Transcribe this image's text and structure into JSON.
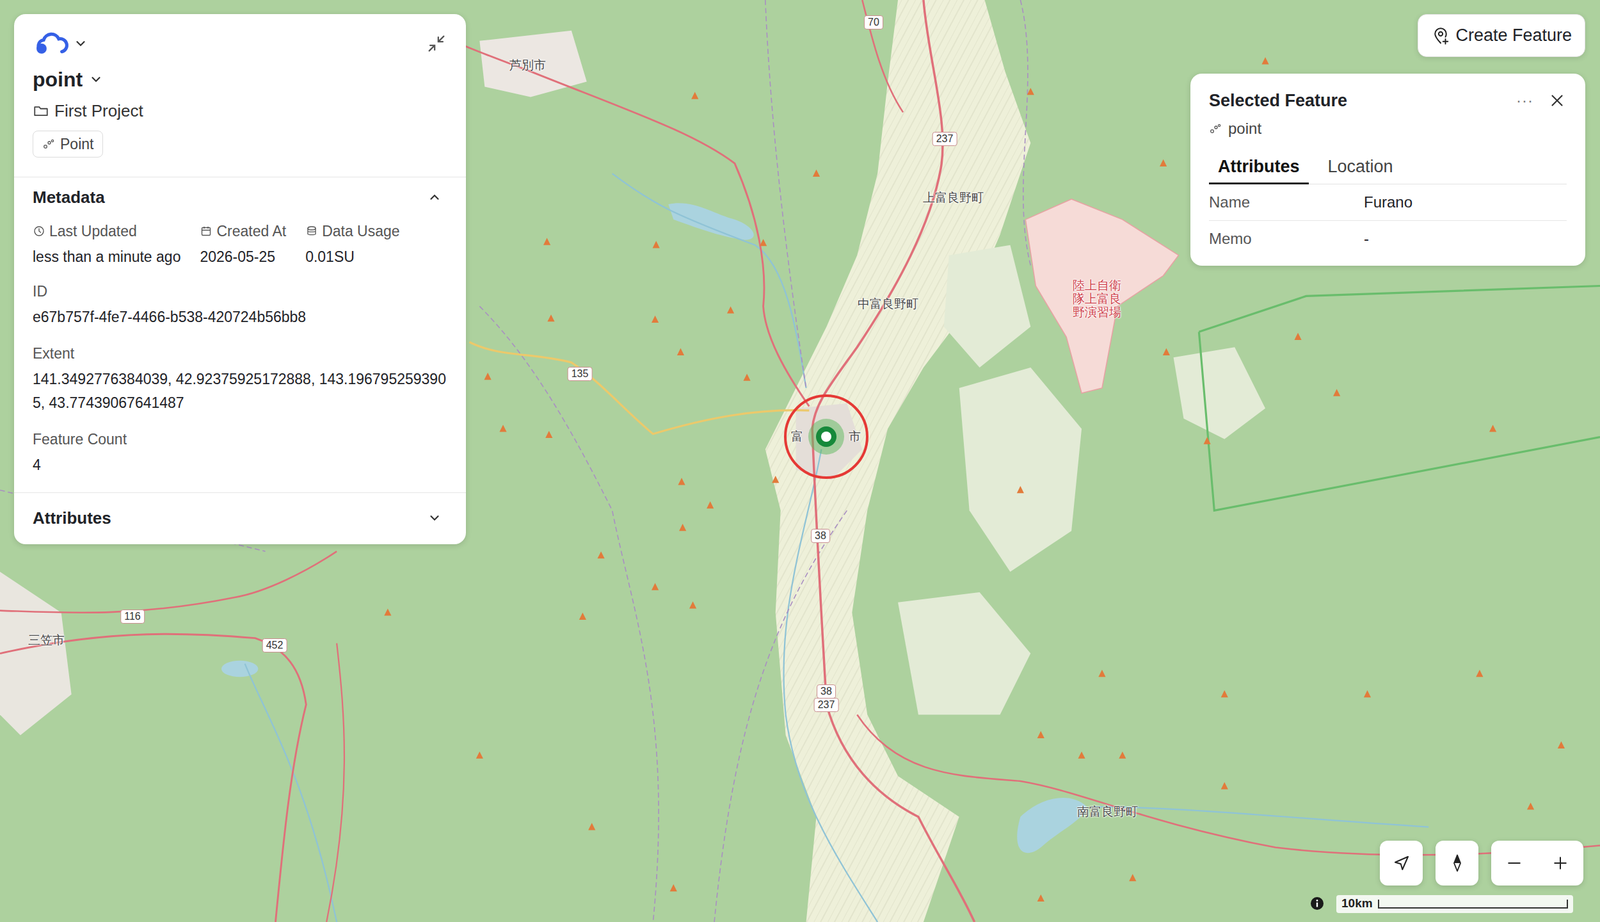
{
  "layer": {
    "name": "point",
    "project": "First Project",
    "geometry_type": "Point"
  },
  "metadata": {
    "title": "Metadata",
    "expanded": true,
    "stats": [
      {
        "label": "Last Updated",
        "value": "less than a minute ago",
        "kind": "time"
      },
      {
        "label": "Created At",
        "value": "2026-05-25",
        "kind": "date"
      },
      {
        "label": "Data Usage",
        "value": "0.01SU",
        "kind": "usage"
      }
    ],
    "fields": [
      {
        "label": "ID",
        "value": "e67b757f-4fe7-4466-b538-420724b56bb8"
      },
      {
        "label": "Extent",
        "value": "141.3492776384039, 42.92375925172888, 143.1967952593905, 43.77439067641487"
      },
      {
        "label": "Feature Count",
        "value": "4"
      }
    ]
  },
  "attributes": {
    "title": "Attributes",
    "expanded": false
  },
  "create_button": "Create Feature",
  "selected_feature": {
    "title": "Selected Feature",
    "menu": "···",
    "layer": "point",
    "tabs": [
      {
        "label": "Attributes",
        "selected": true
      },
      {
        "label": "Location",
        "selected": false
      }
    ],
    "rows": [
      {
        "label": "Name",
        "value": "Furano"
      },
      {
        "label": "Memo",
        "value": "-"
      }
    ]
  },
  "map": {
    "places": [
      {
        "name": "芦別市",
        "kind": "place"
      },
      {
        "name": "上富良野町",
        "kind": "place"
      },
      {
        "name": "中富良野町",
        "kind": "place"
      },
      {
        "name": "富",
        "kind": "place"
      },
      {
        "name": "市",
        "kind": "place"
      },
      {
        "name": "陸上自衛隊上富良野演習場",
        "kind": "area"
      },
      {
        "name": "南富良野町",
        "kind": "place"
      },
      {
        "name": "三笠市",
        "kind": "place"
      }
    ],
    "routes": [
      "70",
      "237",
      "135",
      "38",
      "116",
      "452",
      "38",
      "237"
    ],
    "scale": "10km"
  }
}
